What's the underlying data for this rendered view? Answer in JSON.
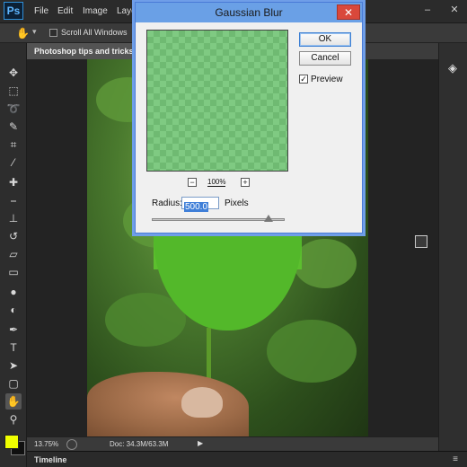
{
  "app": {
    "logo": "Ps"
  },
  "menu": {
    "items": [
      "File",
      "Edit",
      "Image",
      "Laye"
    ]
  },
  "window_controls": {
    "minimize": "–",
    "close": "✕"
  },
  "options_bar": {
    "checkbox_label": "Scroll All Windows",
    "scroll_all_checked": false
  },
  "document": {
    "tab_title": "Photoshop tips and tricks ("
  },
  "dialog": {
    "title": "Gaussian Blur",
    "close_glyph": "✕",
    "ok_label": "OK",
    "cancel_label": "Cancel",
    "preview_label": "Preview",
    "preview_checked": true,
    "zoom_out_glyph": "−",
    "zoom_in_glyph": "+",
    "zoom_value": "100%",
    "radius_label": "Radius:",
    "radius_value": "500.0",
    "radius_unit": "Pixels",
    "radius_slider_fraction": 0.88
  },
  "status": {
    "zoom": "13.75%",
    "doc_size": "Doc: 34.3M/63.3M",
    "arrow": "▶"
  },
  "timeline": {
    "label": "Timeline"
  },
  "colors": {
    "foreground": "#f0ff00",
    "background": "#101010"
  },
  "tools": [
    "move-icon",
    "marquee-icon",
    "lasso-icon",
    "quick-select-icon",
    "crop-icon",
    "eyedropper-icon",
    "healing-icon",
    "brush-icon",
    "stamp-icon",
    "history-brush-icon",
    "eraser-icon",
    "gradient-icon",
    "blur-icon",
    "dodge-icon",
    "pen-icon",
    "type-icon",
    "path-select-icon",
    "shape-icon",
    "hand-icon",
    "zoom-icon"
  ]
}
